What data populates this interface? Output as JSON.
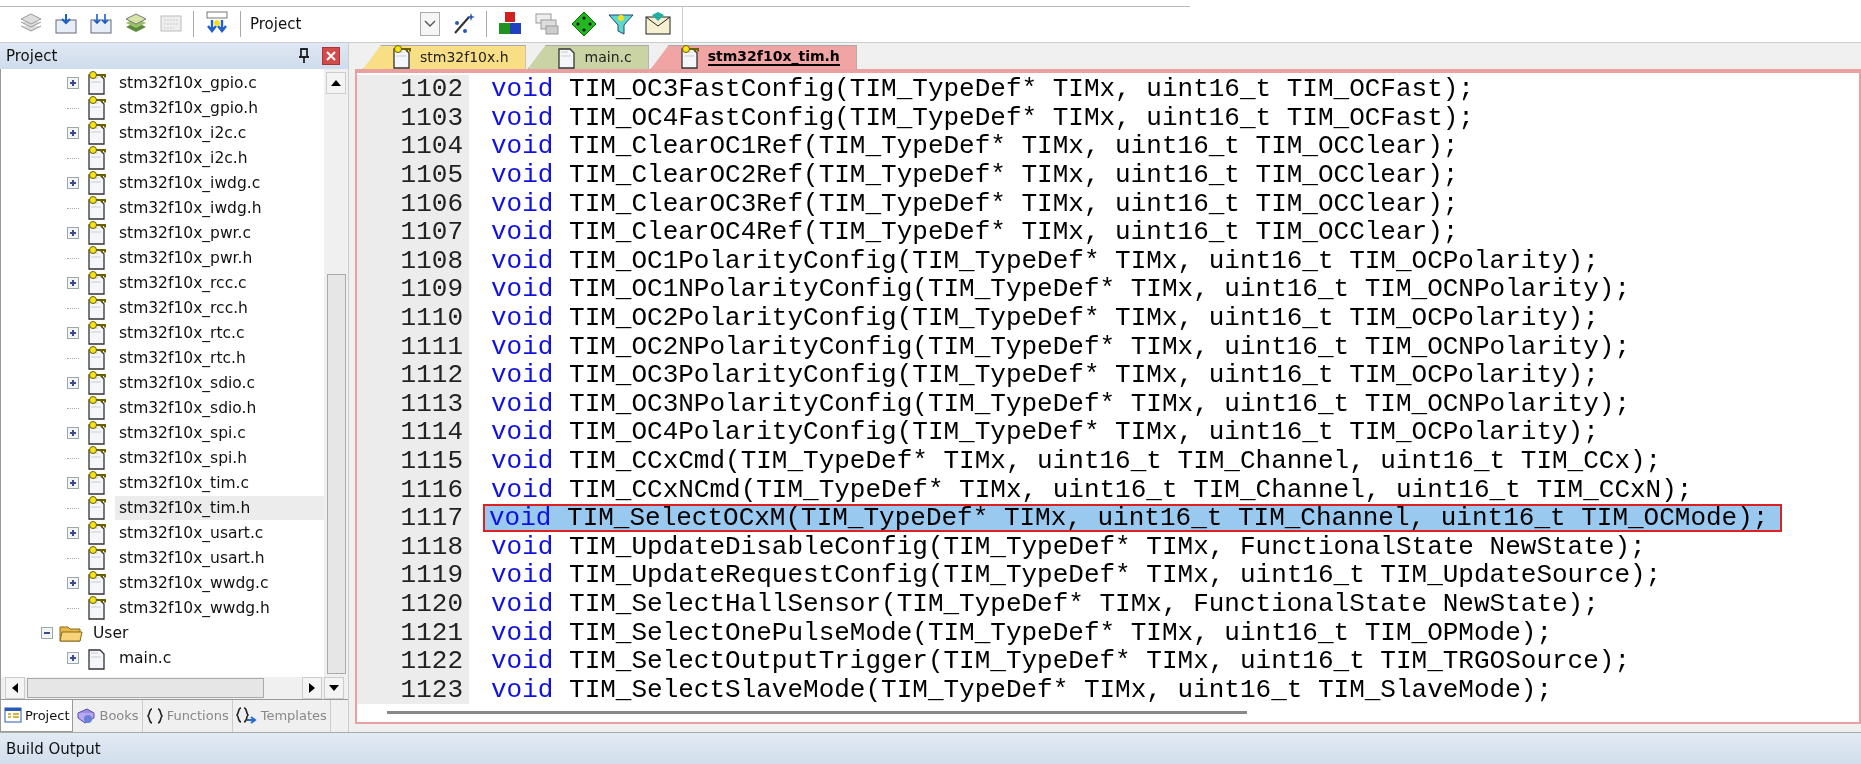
{
  "toolbar": {
    "target": "Project"
  },
  "project_panel": {
    "title": "Project",
    "tree": [
      {
        "children": [
          {
            "label": "stm32f10x_gpio.c",
            "read_only": true,
            "has_children": true,
            "selected": false
          },
          {
            "label": "stm32f10x_gpio.h",
            "read_only": true,
            "has_children": false,
            "selected": false
          },
          {
            "label": "stm32f10x_i2c.c",
            "read_only": true,
            "has_children": true,
            "selected": false
          },
          {
            "label": "stm32f10x_i2c.h",
            "read_only": true,
            "has_children": false,
            "selected": false
          },
          {
            "label": "stm32f10x_iwdg.c",
            "read_only": true,
            "has_children": true,
            "selected": false
          },
          {
            "label": "stm32f10x_iwdg.h",
            "read_only": true,
            "has_children": false,
            "selected": false
          },
          {
            "label": "stm32f10x_pwr.c",
            "read_only": true,
            "has_children": true,
            "selected": false
          },
          {
            "label": "stm32f10x_pwr.h",
            "read_only": true,
            "has_children": false,
            "selected": false
          },
          {
            "label": "stm32f10x_rcc.c",
            "read_only": true,
            "has_children": true,
            "selected": false
          },
          {
            "label": "stm32f10x_rcc.h",
            "read_only": true,
            "has_children": false,
            "selected": false
          },
          {
            "label": "stm32f10x_rtc.c",
            "read_only": true,
            "has_children": true,
            "selected": false
          },
          {
            "label": "stm32f10x_rtc.h",
            "read_only": true,
            "has_children": false,
            "selected": false
          },
          {
            "label": "stm32f10x_sdio.c",
            "read_only": true,
            "has_children": true,
            "selected": false
          },
          {
            "label": "stm32f10x_sdio.h",
            "read_only": true,
            "has_children": false,
            "selected": false
          },
          {
            "label": "stm32f10x_spi.c",
            "read_only": true,
            "has_children": true,
            "selected": false
          },
          {
            "label": "stm32f10x_spi.h",
            "read_only": true,
            "has_children": false,
            "selected": false
          },
          {
            "label": "stm32f10x_tim.c",
            "read_only": true,
            "has_children": true,
            "selected": false
          },
          {
            "label": "stm32f10x_tim.h",
            "read_only": true,
            "has_children": false,
            "selected": true
          },
          {
            "label": "stm32f10x_usart.c",
            "read_only": true,
            "has_children": true,
            "selected": false
          },
          {
            "label": "stm32f10x_usart.h",
            "read_only": true,
            "has_children": false,
            "selected": false
          },
          {
            "label": "stm32f10x_wwdg.c",
            "read_only": true,
            "has_children": true,
            "selected": false
          },
          {
            "label": "stm32f10x_wwdg.h",
            "read_only": true,
            "has_children": false,
            "selected": false
          }
        ]
      },
      {
        "label": "User",
        "kind": "folder",
        "expanded": true,
        "children": [
          {
            "label": "main.c",
            "read_only": false,
            "has_children": true,
            "selected": false
          }
        ]
      }
    ],
    "tabs": [
      {
        "label": "Project",
        "selected": true
      },
      {
        "label": "Books",
        "selected": false
      },
      {
        "label": "Functions",
        "selected": false
      },
      {
        "label": "Templates",
        "selected": false
      }
    ]
  },
  "editor": {
    "tabs": [
      {
        "label": "stm32f10x.h",
        "read_only": true,
        "color": "#f8de84",
        "selected": false
      },
      {
        "label": "main.c",
        "read_only": false,
        "color": "#c9d3a4",
        "selected": false
      },
      {
        "label": "stm32f10x_tim.h",
        "read_only": true,
        "color": "#f0a4a4",
        "selected": true
      }
    ],
    "lines": [
      {
        "number": "1102",
        "keyword": "void",
        "code": "TIM_OC3FastConfig(TIM_TypeDef* TIMx, uint16_t TIM_OCFast);",
        "selected": false,
        "boxed": false
      },
      {
        "number": "1103",
        "keyword": "void",
        "code": "TIM_OC4FastConfig(TIM_TypeDef* TIMx, uint16_t TIM_OCFast);",
        "selected": false,
        "boxed": false
      },
      {
        "number": "1104",
        "keyword": "void",
        "code": "TIM_ClearOC1Ref(TIM_TypeDef* TIMx, uint16_t TIM_OCClear);",
        "selected": false,
        "boxed": false
      },
      {
        "number": "1105",
        "keyword": "void",
        "code": "TIM_ClearOC2Ref(TIM_TypeDef* TIMx, uint16_t TIM_OCClear);",
        "selected": false,
        "boxed": false
      },
      {
        "number": "1106",
        "keyword": "void",
        "code": "TIM_ClearOC3Ref(TIM_TypeDef* TIMx, uint16_t TIM_OCClear);",
        "selected": false,
        "boxed": false
      },
      {
        "number": "1107",
        "keyword": "void",
        "code": "TIM_ClearOC4Ref(TIM_TypeDef* TIMx, uint16_t TIM_OCClear);",
        "selected": false,
        "boxed": false
      },
      {
        "number": "1108",
        "keyword": "void",
        "code": "TIM_OC1PolarityConfig(TIM_TypeDef* TIMx, uint16_t TIM_OCPolarity);",
        "selected": false,
        "boxed": false
      },
      {
        "number": "1109",
        "keyword": "void",
        "code": "TIM_OC1NPolarityConfig(TIM_TypeDef* TIMx, uint16_t TIM_OCNPolarity);",
        "selected": false,
        "boxed": false
      },
      {
        "number": "1110",
        "keyword": "void",
        "code": "TIM_OC2PolarityConfig(TIM_TypeDef* TIMx, uint16_t TIM_OCPolarity);",
        "selected": false,
        "boxed": false
      },
      {
        "number": "1111",
        "keyword": "void",
        "code": "TIM_OC2NPolarityConfig(TIM_TypeDef* TIMx, uint16_t TIM_OCNPolarity);",
        "selected": false,
        "boxed": false
      },
      {
        "number": "1112",
        "keyword": "void",
        "code": "TIM_OC3PolarityConfig(TIM_TypeDef* TIMx, uint16_t TIM_OCPolarity);",
        "selected": false,
        "boxed": false
      },
      {
        "number": "1113",
        "keyword": "void",
        "code": "TIM_OC3NPolarityConfig(TIM_TypeDef* TIMx, uint16_t TIM_OCNPolarity);",
        "selected": false,
        "boxed": false
      },
      {
        "number": "1114",
        "keyword": "void",
        "code": "TIM_OC4PolarityConfig(TIM_TypeDef* TIMx, uint16_t TIM_OCPolarity);",
        "selected": false,
        "boxed": false
      },
      {
        "number": "1115",
        "keyword": "void",
        "code": "TIM_CCxCmd(TIM_TypeDef* TIMx, uint16_t TIM_Channel, uint16_t TIM_CCx);",
        "selected": false,
        "boxed": false
      },
      {
        "number": "1116",
        "keyword": "void",
        "code": "TIM_CCxNCmd(TIM_TypeDef* TIMx, uint16_t TIM_Channel, uint16_t TIM_CCxN);",
        "selected": false,
        "boxed": false
      },
      {
        "number": "1117",
        "keyword": "void",
        "code": "TIM_SelectOCxM(TIM_TypeDef* TIMx, uint16_t TIM_Channel, uint16_t TIM_OCMode);",
        "selected": true,
        "boxed": true
      },
      {
        "number": "1118",
        "keyword": "void",
        "code": "TIM_UpdateDisableConfig(TIM_TypeDef* TIMx, FunctionalState NewState);",
        "selected": false,
        "boxed": false
      },
      {
        "number": "1119",
        "keyword": "void",
        "code": "TIM_UpdateRequestConfig(TIM_TypeDef* TIMx, uint16_t TIM_UpdateSource);",
        "selected": false,
        "boxed": false
      },
      {
        "number": "1120",
        "keyword": "void",
        "code": "TIM_SelectHallSensor(TIM_TypeDef* TIMx, FunctionalState NewState);",
        "selected": false,
        "boxed": false
      },
      {
        "number": "1121",
        "keyword": "void",
        "code": "TIM_SelectOnePulseMode(TIM_TypeDef* TIMx, uint16_t TIM_OPMode);",
        "selected": false,
        "boxed": false
      },
      {
        "number": "1122",
        "keyword": "void",
        "code": "TIM_SelectOutputTrigger(TIM_TypeDef* TIMx, uint16_t TIM_TRGOSource);",
        "selected": false,
        "boxed": false
      },
      {
        "number": "1123",
        "keyword": "void",
        "code": "TIM_SelectSlaveMode(TIM_TypeDef* TIMx, uint16_t TIM_SlaveMode);",
        "selected": false,
        "boxed": false
      }
    ]
  },
  "build_output": {
    "title": "Build Output"
  }
}
